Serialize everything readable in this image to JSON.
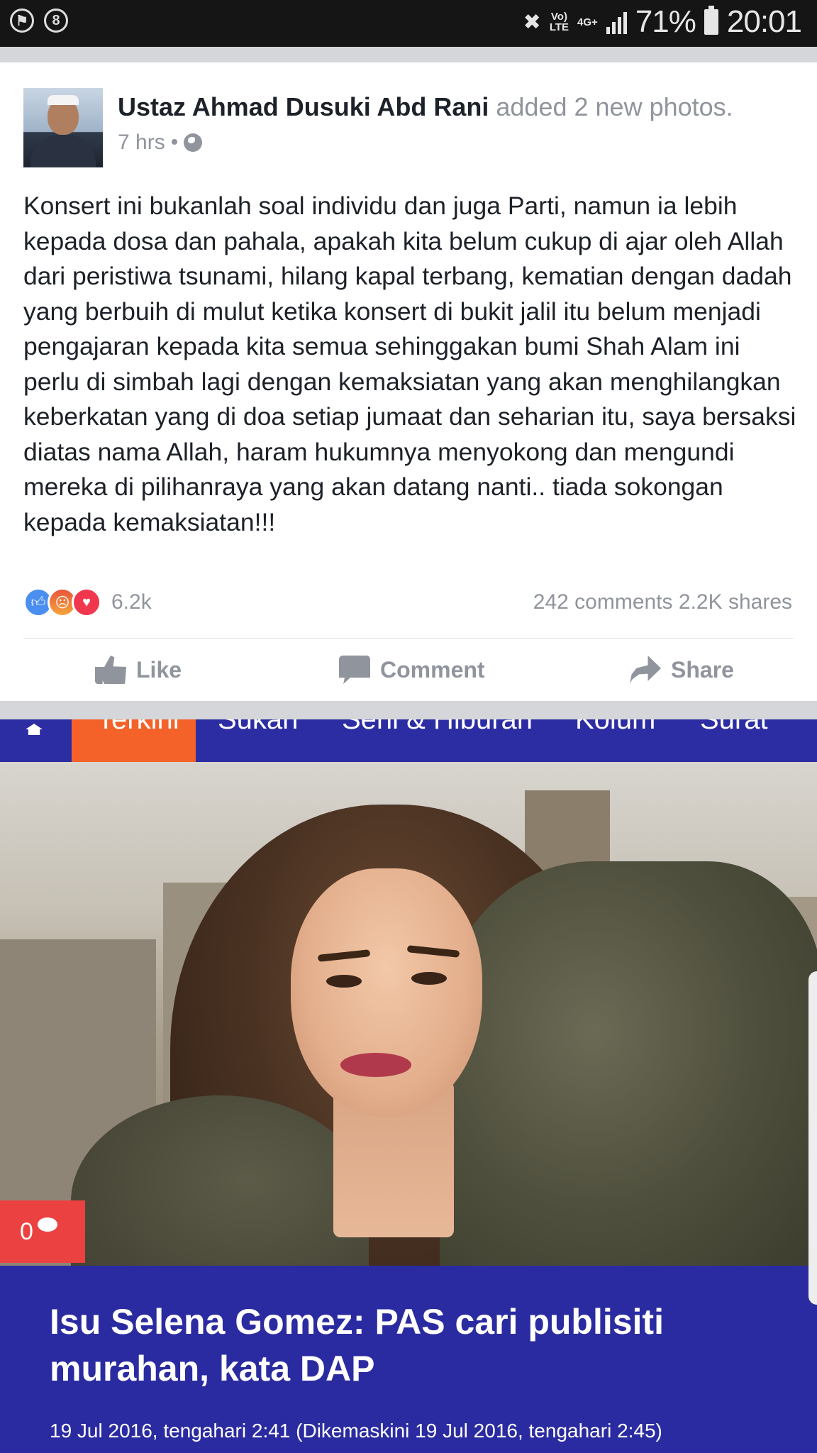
{
  "status_bar": {
    "battery": "71%",
    "time": "20:01",
    "network_top": "Vo)",
    "network_bottom": "LTE",
    "data_type": "4G+",
    "notif_badge": "8"
  },
  "post": {
    "author": "Ustaz Ahmad Dusuki Abd Rani",
    "action": " added 2 new photos.",
    "time": "7 hrs",
    "privacy_icon": "globe-icon",
    "body": "Konsert ini bukanlah soal individu dan juga Parti, namun ia lebih kepada dosa dan pahala, apakah kita belum cukup di ajar oleh Allah dari peristiwa tsunami, hilang kapal terbang, kematian dengan dadah yang berbuih di mulut ketika konsert di bukit jalil itu belum menjadi pengajaran kepada kita semua sehinggakan bumi Shah Alam ini perlu di simbah lagi dengan kemaksiatan yang akan menghilangkan keberkatan yang di doa setiap jumaat dan seharian itu, saya bersaksi diatas nama Allah, haram hukumnya menyokong dan mengundi mereka di pilihanraya yang akan datang nanti.. tiada sokongan kepada kemaksiatan!!!",
    "reaction_count": "6.2k",
    "comments": "242 comments",
    "shares": "2.2K shares",
    "actions": {
      "like": "Like",
      "comment": "Comment",
      "share": "Share"
    }
  },
  "article": {
    "nav": [
      "Terkini",
      "Sukan",
      "Seni & Hiburan",
      "Kolum",
      "Surat"
    ],
    "comment_count": "0",
    "headline": "Isu Selena Gomez: PAS cari publisiti murahan, kata DAP",
    "dateline": "19 Jul 2016, tengahari 2:41 (Dikemaskini 19 Jul 2016, tengahari 2:45)"
  },
  "colors": {
    "facebook_text": "#1d2129",
    "meta_gray": "#90949c",
    "article_nav": "#2d2da3",
    "nav_active": "#f4622a",
    "comment_badge": "#ec4141"
  }
}
